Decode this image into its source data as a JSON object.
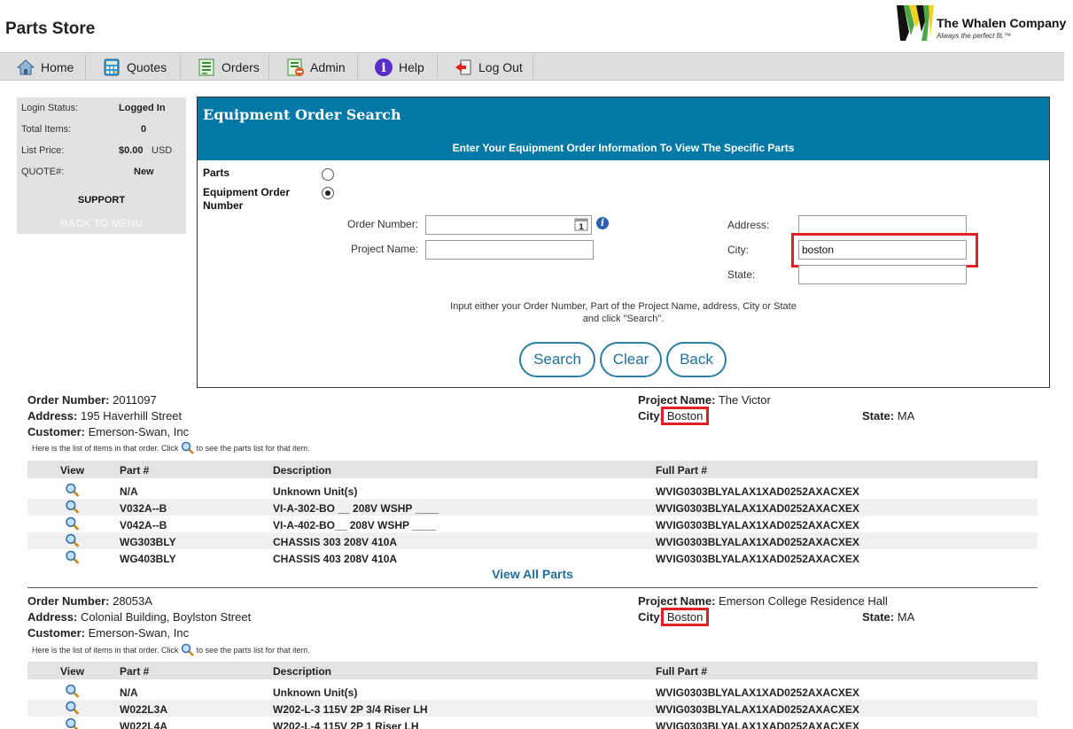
{
  "app": {
    "title": "Parts Store",
    "logo_text": "The Whalen Company",
    "logo_tagline": "Always the perfect fit.™"
  },
  "nav": [
    {
      "label": "Home",
      "icon": "home-icon"
    },
    {
      "label": "Quotes",
      "icon": "calculator-icon"
    },
    {
      "label": "Orders",
      "icon": "orders-icon"
    },
    {
      "label": "Admin",
      "icon": "admin-icon"
    },
    {
      "label": "Help",
      "icon": "help-icon"
    },
    {
      "label": "Log Out",
      "icon": "logout-icon"
    }
  ],
  "status": {
    "login_label": "Login Status:",
    "login_value": "Logged In",
    "items_label": "Total Items:",
    "items_value": "0",
    "price_label": "List Price:",
    "price_value": "$0.00",
    "price_unit": "USD",
    "quote_label": "QUOTE#:",
    "quote_value": "New",
    "support": "SUPPORT",
    "back": "BACK TO MENU"
  },
  "search": {
    "title": "Equipment Order Search",
    "subtitle": "Enter Your Equipment Order Information To View The Specific Parts",
    "opt_parts": "Parts",
    "opt_equipment": "Equipment Order Number",
    "order_number_label": "Order Number:",
    "order_number_value": "",
    "project_name_label": "Project Name:",
    "project_name_value": "",
    "address_label": "Address:",
    "address_value": "",
    "city_label": "City:",
    "city_value": "boston",
    "state_label": "State:",
    "state_value": "",
    "hint_line1": "Input either your Order Number, Part of the Project Name, address, City or State",
    "hint_line2": "and click \"Search\".",
    "btn_search": "Search",
    "btn_clear": "Clear",
    "btn_back": "Back"
  },
  "results": {
    "order_label": "Order Number:",
    "address_label": "Address:",
    "customer_label": "Customer:",
    "project_label": "Project Name:",
    "city_label": "City:",
    "state_label": "State:",
    "hint_pre": "Here is the list of items in that order. Click",
    "hint_post": "to see the parts list for that item.",
    "col_view": "View",
    "col_part": "Part #",
    "col_desc": "Description",
    "col_full": "Full Part #",
    "view_all": "View All Parts",
    "orders": [
      {
        "order_number": "2011097",
        "address": "195 Haverhill Street",
        "customer": "Emerson-Swan, Inc",
        "project": "The Victor",
        "city": "Boston",
        "state": "MA",
        "rows": [
          {
            "part": "N/A",
            "desc": "Unknown Unit(s)",
            "full": "WVIG0303BLYALAX1XAD0252AXACXEX"
          },
          {
            "part": "V032A--B",
            "desc": "VI-A-302-BO __ 208V WSHP ____",
            "full": "WVIG0303BLYALAX1XAD0252AXACXEX"
          },
          {
            "part": "V042A--B",
            "desc": "VI-A-402-BO__ 208V WSHP ____",
            "full": "WVIG0303BLYALAX1XAD0252AXACXEX"
          },
          {
            "part": "WG303BLY",
            "desc": "CHASSIS 303 208V 410A",
            "full": "WVIG0303BLYALAX1XAD0252AXACXEX"
          },
          {
            "part": "WG403BLY",
            "desc": "CHASSIS 403 208V 410A",
            "full": "WVIG0303BLYALAX1XAD0252AXACXEX"
          }
        ]
      },
      {
        "order_number": "28053A",
        "address": "Colonial Building, Boylston Street",
        "customer": "Emerson-Swan, Inc",
        "project": "Emerson College Residence Hall",
        "city": "Boston",
        "state": "MA",
        "rows": [
          {
            "part": "N/A",
            "desc": "Unknown Unit(s)",
            "full": "WVIG0303BLYALAX1XAD0252AXACXEX"
          },
          {
            "part": "W022L3A",
            "desc": "W202-L-3 115V 2P 3/4 Riser LH",
            "full": "WVIG0303BLYALAX1XAD0252AXACXEX"
          },
          {
            "part": "W022L4A",
            "desc": "W202-L-4 115V 2P 1 Riser LH",
            "full": "WVIG0303BLYALAX1XAD0252AXACXEX"
          }
        ]
      }
    ]
  }
}
